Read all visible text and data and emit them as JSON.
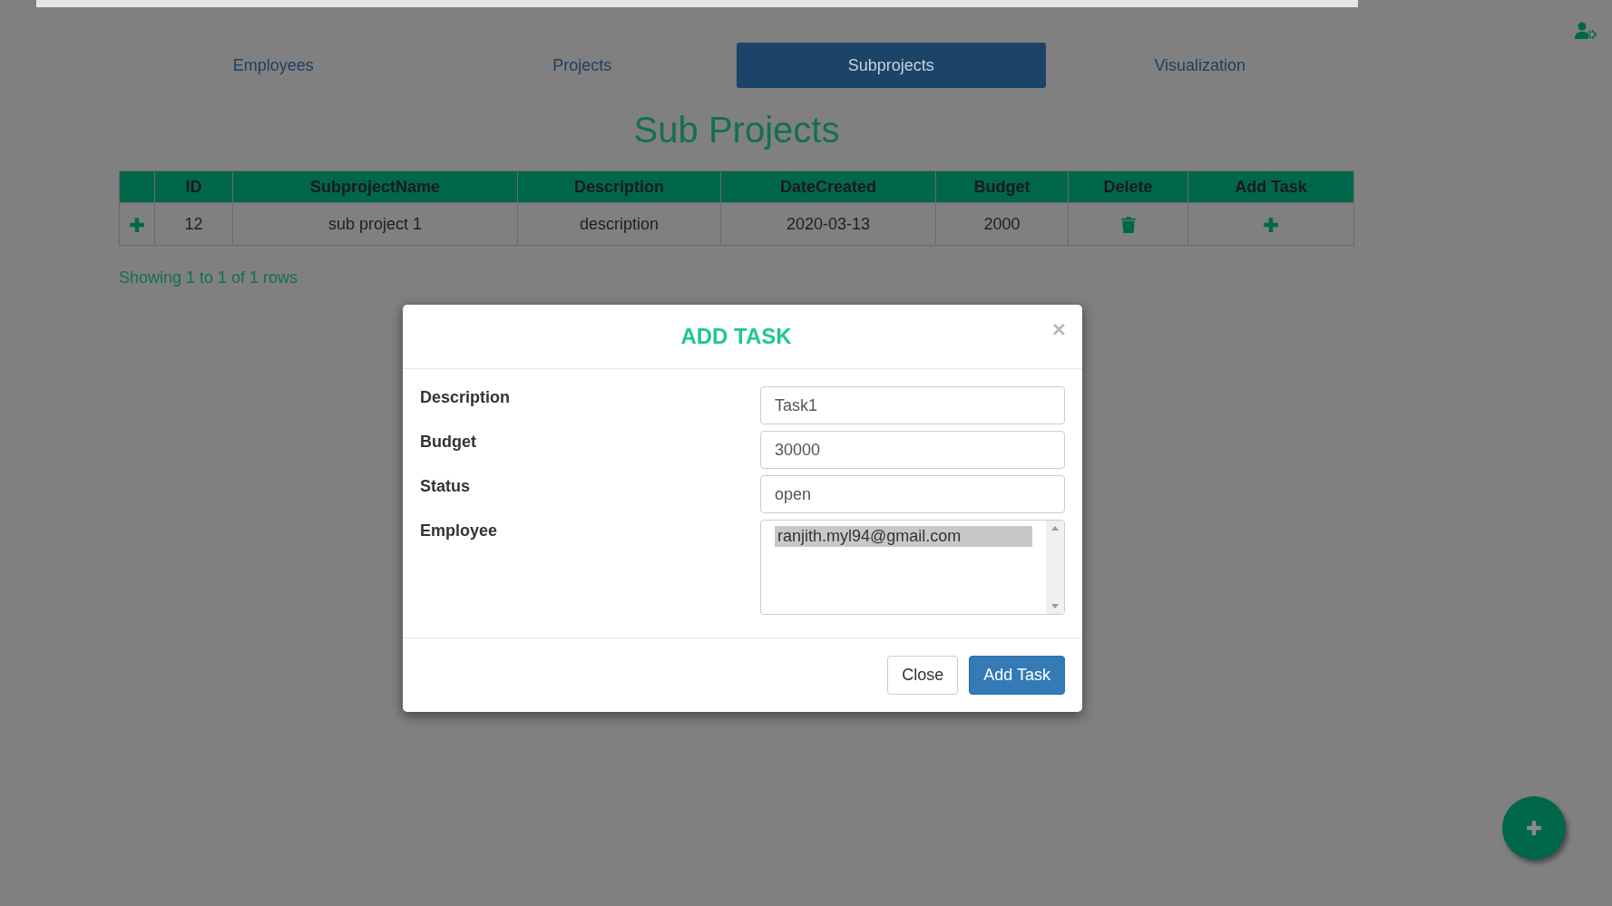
{
  "tabs": [
    {
      "label": "Employees",
      "selected": false
    },
    {
      "label": "Projects",
      "selected": false
    },
    {
      "label": "Subprojects",
      "selected": true
    },
    {
      "label": "Visualization",
      "selected": false
    }
  ],
  "title": "Sub Projects",
  "table": {
    "columns": [
      "ID",
      "SubprojectName",
      "Description",
      "DateCreated",
      "Budget",
      "Delete",
      "Add Task"
    ],
    "rows": [
      {
        "cells": [
          "12",
          "sub project 1",
          "description",
          "2020-03-13",
          "2000"
        ]
      }
    ]
  },
  "pagination": "Showing 1 to 1 of 1 rows",
  "modal": {
    "title": "ADD TASK",
    "close": "×",
    "fields": [
      {
        "kind": "text",
        "label": "Description",
        "value": "Task1"
      },
      {
        "kind": "text",
        "label": "Budget",
        "value": "30000"
      },
      {
        "kind": "text",
        "label": "Status",
        "value": "open"
      },
      {
        "kind": "list",
        "label": "Employee",
        "options": [
          {
            "label": "ranjith.myl94@gmail.com",
            "selected": true
          }
        ]
      }
    ],
    "buttons": [
      {
        "kind": "default",
        "label": "Close"
      },
      {
        "kind": "primary",
        "label": "Add Task"
      }
    ]
  }
}
